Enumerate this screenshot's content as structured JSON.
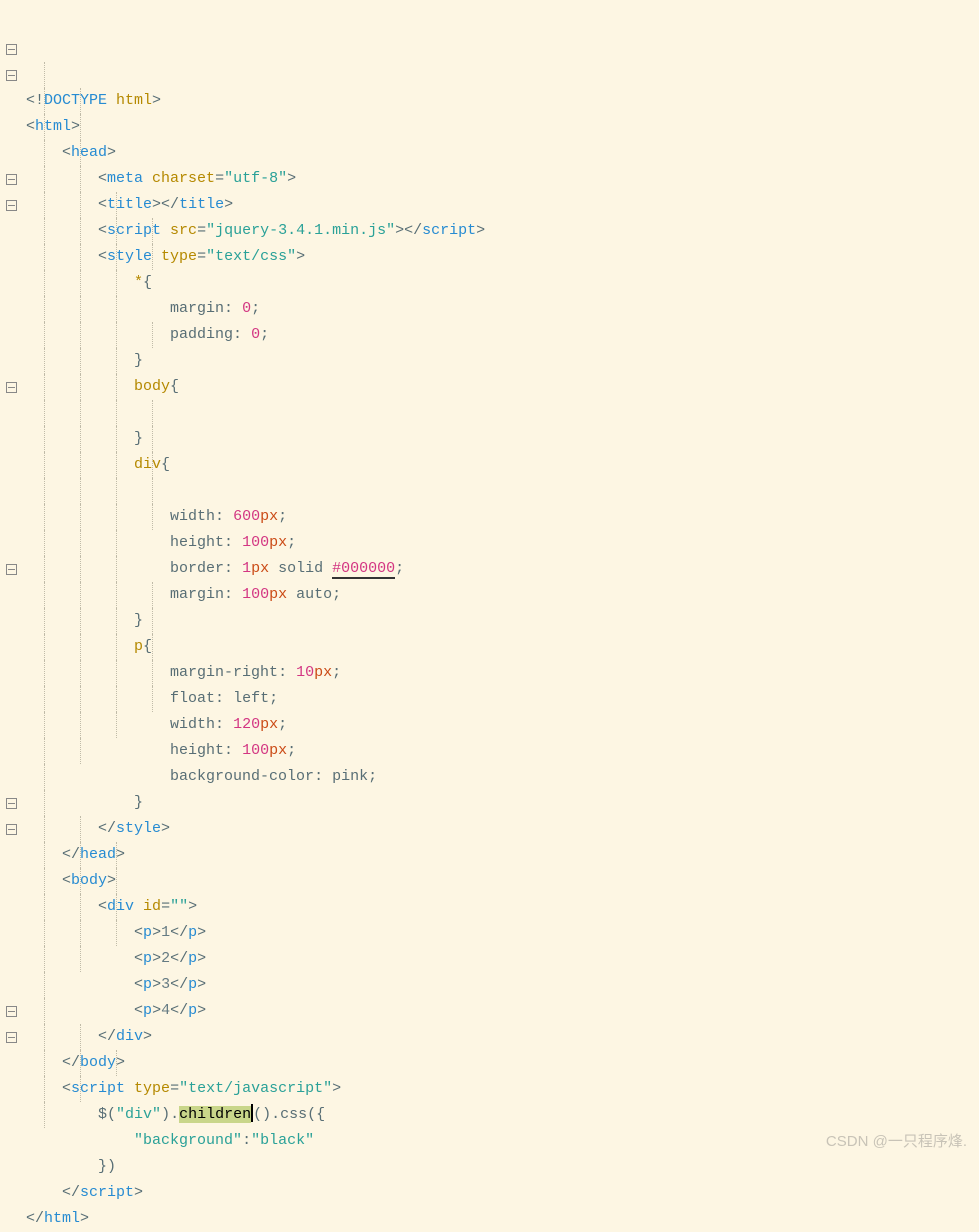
{
  "watermark": "CSDN @一只程序烽.",
  "folds": [
    0,
    1,
    1,
    0,
    0,
    0,
    1,
    1,
    0,
    0,
    0,
    0,
    0,
    0,
    1,
    0,
    0,
    0,
    0,
    0,
    0,
    1,
    0,
    0,
    0,
    0,
    0,
    0,
    0,
    0,
    1,
    1,
    0,
    0,
    0,
    0,
    0,
    0,
    1,
    1,
    0,
    0,
    0,
    0
  ],
  "fold_heights": {
    "1": 1118,
    "2": 702,
    "6": 572,
    "7": 78,
    "14": 182,
    "21": 182,
    "30": 208,
    "31": 156,
    "38": 156,
    "39": 78
  },
  "lines": [
    {
      "ind": 0,
      "seg": [
        [
          "punct",
          "<!"
        ],
        [
          "tag",
          "DOCTYPE "
        ],
        [
          "attr",
          "html"
        ],
        [
          "punct",
          ">"
        ]
      ]
    },
    {
      "ind": 0,
      "seg": [
        [
          "punct",
          "<"
        ],
        [
          "tag",
          "html"
        ],
        [
          "punct",
          ">"
        ]
      ]
    },
    {
      "ind": 1,
      "seg": [
        [
          "punct",
          "<"
        ],
        [
          "tag",
          "head"
        ],
        [
          "punct",
          ">"
        ]
      ]
    },
    {
      "ind": 2,
      "seg": [
        [
          "punct",
          "<"
        ],
        [
          "tag",
          "meta "
        ],
        [
          "attr",
          "charset"
        ],
        [
          "punct",
          "="
        ],
        [
          "str",
          "\"utf-8\""
        ],
        [
          "punct",
          ">"
        ]
      ]
    },
    {
      "ind": 2,
      "seg": [
        [
          "punct",
          "<"
        ],
        [
          "tag",
          "title"
        ],
        [
          "punct",
          "></"
        ],
        [
          "tag",
          "title"
        ],
        [
          "punct",
          ">"
        ]
      ]
    },
    {
      "ind": 2,
      "seg": [
        [
          "punct",
          "<"
        ],
        [
          "tag",
          "script "
        ],
        [
          "attr",
          "src"
        ],
        [
          "punct",
          "="
        ],
        [
          "str",
          "\"jquery-3.4.1.min.js\""
        ],
        [
          "punct",
          "></"
        ],
        [
          "tag",
          "script"
        ],
        [
          "punct",
          ">"
        ]
      ]
    },
    {
      "ind": 2,
      "seg": [
        [
          "punct",
          "<"
        ],
        [
          "tag",
          "style "
        ],
        [
          "attr",
          "type"
        ],
        [
          "punct",
          "="
        ],
        [
          "str",
          "\"text/css\""
        ],
        [
          "punct",
          ">"
        ]
      ]
    },
    {
      "ind": 3,
      "seg": [
        [
          "sel",
          "*"
        ],
        [
          "punct",
          "{"
        ]
      ]
    },
    {
      "ind": 4,
      "seg": [
        [
          "prop",
          "margin"
        ],
        [
          "punct",
          ": "
        ],
        [
          "num",
          "0"
        ],
        [
          "punct",
          ";"
        ]
      ]
    },
    {
      "ind": 4,
      "seg": [
        [
          "prop",
          "padding"
        ],
        [
          "punct",
          ": "
        ],
        [
          "num",
          "0"
        ],
        [
          "punct",
          ";"
        ]
      ]
    },
    {
      "ind": 3,
      "seg": [
        [
          "punct",
          "}"
        ]
      ]
    },
    {
      "ind": 3,
      "seg": [
        [
          "sel",
          "body"
        ],
        [
          "punct",
          "{"
        ]
      ]
    },
    {
      "ind": 4,
      "seg": []
    },
    {
      "ind": 3,
      "seg": [
        [
          "punct",
          "}"
        ]
      ]
    },
    {
      "ind": 3,
      "seg": [
        [
          "sel",
          "div"
        ],
        [
          "punct",
          "{"
        ]
      ]
    },
    {
      "ind": 4,
      "seg": []
    },
    {
      "ind": 4,
      "seg": [
        [
          "prop",
          "width"
        ],
        [
          "punct",
          ": "
        ],
        [
          "num",
          "600"
        ],
        [
          "unit",
          "px"
        ],
        [
          "punct",
          ";"
        ]
      ]
    },
    {
      "ind": 4,
      "seg": [
        [
          "prop",
          "height"
        ],
        [
          "punct",
          ": "
        ],
        [
          "num",
          "100"
        ],
        [
          "unit",
          "px"
        ],
        [
          "punct",
          ";"
        ]
      ]
    },
    {
      "ind": 4,
      "seg": [
        [
          "prop",
          "border"
        ],
        [
          "punct",
          ": "
        ],
        [
          "num",
          "1"
        ],
        [
          "unit",
          "px"
        ],
        [
          "kw",
          " solid "
        ],
        [
          "hexul",
          "#000000"
        ],
        [
          "punct",
          ";"
        ]
      ]
    },
    {
      "ind": 4,
      "seg": [
        [
          "prop",
          "margin"
        ],
        [
          "punct",
          ": "
        ],
        [
          "num",
          "100"
        ],
        [
          "unit",
          "px"
        ],
        [
          "kw",
          " auto"
        ],
        [
          "punct",
          ";"
        ]
      ]
    },
    {
      "ind": 3,
      "seg": [
        [
          "punct",
          "}"
        ]
      ]
    },
    {
      "ind": 3,
      "seg": [
        [
          "sel",
          "p"
        ],
        [
          "punct",
          "{"
        ]
      ]
    },
    {
      "ind": 4,
      "seg": [
        [
          "prop",
          "margin-right"
        ],
        [
          "punct",
          ": "
        ],
        [
          "num",
          "10"
        ],
        [
          "unit",
          "px"
        ],
        [
          "punct",
          ";"
        ]
      ]
    },
    {
      "ind": 4,
      "seg": [
        [
          "prop",
          "float"
        ],
        [
          "punct",
          ": "
        ],
        [
          "kw",
          "left"
        ],
        [
          "punct",
          ";"
        ]
      ]
    },
    {
      "ind": 4,
      "seg": [
        [
          "prop",
          "width"
        ],
        [
          "punct",
          ": "
        ],
        [
          "num",
          "120"
        ],
        [
          "unit",
          "px"
        ],
        [
          "punct",
          ";"
        ]
      ]
    },
    {
      "ind": 4,
      "seg": [
        [
          "prop",
          "height"
        ],
        [
          "punct",
          ": "
        ],
        [
          "num",
          "100"
        ],
        [
          "unit",
          "px"
        ],
        [
          "punct",
          ";"
        ]
      ]
    },
    {
      "ind": 4,
      "seg": [
        [
          "prop",
          "background-color"
        ],
        [
          "punct",
          ": "
        ],
        [
          "kw",
          "pink"
        ],
        [
          "punct",
          ";"
        ]
      ]
    },
    {
      "ind": 3,
      "seg": [
        [
          "punct",
          "}"
        ]
      ]
    },
    {
      "ind": 2,
      "seg": [
        [
          "punct",
          "</"
        ],
        [
          "tag",
          "style"
        ],
        [
          "punct",
          ">"
        ]
      ]
    },
    {
      "ind": 1,
      "seg": [
        [
          "punct",
          "</"
        ],
        [
          "tag",
          "head"
        ],
        [
          "punct",
          ">"
        ]
      ]
    },
    {
      "ind": 1,
      "seg": [
        [
          "punct",
          "<"
        ],
        [
          "tag",
          "body"
        ],
        [
          "punct",
          ">"
        ]
      ]
    },
    {
      "ind": 2,
      "seg": [
        [
          "punct",
          "<"
        ],
        [
          "tag",
          "div "
        ],
        [
          "attr",
          "id"
        ],
        [
          "punct",
          "="
        ],
        [
          "str",
          "\"\""
        ],
        [
          "punct",
          ">"
        ]
      ]
    },
    {
      "ind": 3,
      "seg": [
        [
          "punct",
          "<"
        ],
        [
          "tag",
          "p"
        ],
        [
          "punct",
          ">"
        ],
        [
          "txt",
          "1"
        ],
        [
          "punct",
          "</"
        ],
        [
          "tag",
          "p"
        ],
        [
          "punct",
          ">"
        ]
      ]
    },
    {
      "ind": 3,
      "seg": [
        [
          "punct",
          "<"
        ],
        [
          "tag",
          "p"
        ],
        [
          "punct",
          ">"
        ],
        [
          "txt",
          "2"
        ],
        [
          "punct",
          "</"
        ],
        [
          "tag",
          "p"
        ],
        [
          "punct",
          ">"
        ]
      ]
    },
    {
      "ind": 3,
      "seg": [
        [
          "punct",
          "<"
        ],
        [
          "tag",
          "p"
        ],
        [
          "punct",
          ">"
        ],
        [
          "txt",
          "3"
        ],
        [
          "punct",
          "</"
        ],
        [
          "tag",
          "p"
        ],
        [
          "punct",
          ">"
        ]
      ]
    },
    {
      "ind": 3,
      "seg": [
        [
          "punct",
          "<"
        ],
        [
          "tag",
          "p"
        ],
        [
          "punct",
          ">"
        ],
        [
          "txt",
          "4"
        ],
        [
          "punct",
          "</"
        ],
        [
          "tag",
          "p"
        ],
        [
          "punct",
          ">"
        ]
      ]
    },
    {
      "ind": 2,
      "seg": [
        [
          "punct",
          "</"
        ],
        [
          "tag",
          "div"
        ],
        [
          "punct",
          ">"
        ]
      ]
    },
    {
      "ind": 1,
      "seg": [
        [
          "punct",
          "</"
        ],
        [
          "tag",
          "body"
        ],
        [
          "punct",
          ">"
        ]
      ]
    },
    {
      "ind": 1,
      "seg": [
        [
          "punct",
          "<"
        ],
        [
          "tag",
          "script "
        ],
        [
          "attr",
          "type"
        ],
        [
          "punct",
          "="
        ],
        [
          "str",
          "\"text/javascript\""
        ],
        [
          "punct",
          ">"
        ]
      ]
    },
    {
      "ind": 2,
      "seg": [
        [
          "fn",
          "$"
        ],
        [
          "punct",
          "("
        ],
        [
          "str",
          "\"div\""
        ],
        [
          "punct",
          ")."
        ],
        [
          "hl",
          "children"
        ],
        [
          "cursor",
          ""
        ],
        [
          "punct",
          "()."
        ],
        [
          "fn",
          "css"
        ],
        [
          "punct",
          "({"
        ]
      ]
    },
    {
      "ind": 3,
      "seg": [
        [
          "str",
          "\"background\""
        ],
        [
          "punct",
          ":"
        ],
        [
          "str",
          "\"black\""
        ]
      ]
    },
    {
      "ind": 2,
      "seg": [
        [
          "punct",
          "})"
        ]
      ]
    },
    {
      "ind": 1,
      "seg": [
        [
          "punct",
          "</"
        ],
        [
          "tag",
          "script"
        ],
        [
          "punct",
          ">"
        ]
      ]
    },
    {
      "ind": 0,
      "seg": [
        [
          "punct",
          "</"
        ],
        [
          "tag",
          "html"
        ],
        [
          "punct",
          ">"
        ]
      ]
    }
  ]
}
